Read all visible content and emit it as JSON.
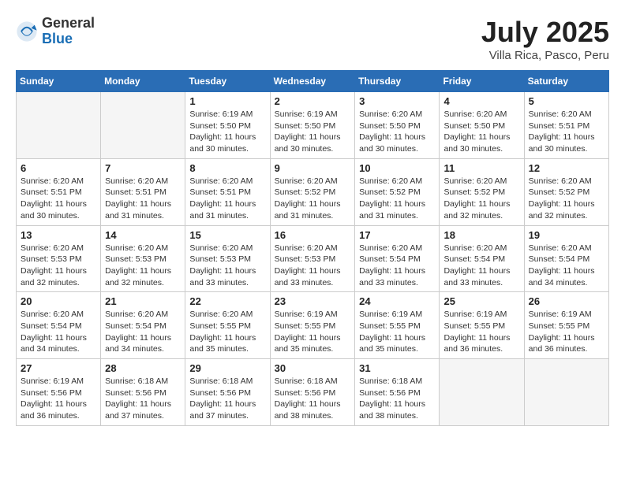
{
  "header": {
    "logo_general": "General",
    "logo_blue": "Blue",
    "month_title": "July 2025",
    "subtitle": "Villa Rica, Pasco, Peru"
  },
  "weekdays": [
    "Sunday",
    "Monday",
    "Tuesday",
    "Wednesday",
    "Thursday",
    "Friday",
    "Saturday"
  ],
  "weeks": [
    [
      {
        "day": "",
        "info": ""
      },
      {
        "day": "",
        "info": ""
      },
      {
        "day": "1",
        "info": "Sunrise: 6:19 AM\nSunset: 5:50 PM\nDaylight: 11 hours and 30 minutes."
      },
      {
        "day": "2",
        "info": "Sunrise: 6:19 AM\nSunset: 5:50 PM\nDaylight: 11 hours and 30 minutes."
      },
      {
        "day": "3",
        "info": "Sunrise: 6:20 AM\nSunset: 5:50 PM\nDaylight: 11 hours and 30 minutes."
      },
      {
        "day": "4",
        "info": "Sunrise: 6:20 AM\nSunset: 5:50 PM\nDaylight: 11 hours and 30 minutes."
      },
      {
        "day": "5",
        "info": "Sunrise: 6:20 AM\nSunset: 5:51 PM\nDaylight: 11 hours and 30 minutes."
      }
    ],
    [
      {
        "day": "6",
        "info": "Sunrise: 6:20 AM\nSunset: 5:51 PM\nDaylight: 11 hours and 30 minutes."
      },
      {
        "day": "7",
        "info": "Sunrise: 6:20 AM\nSunset: 5:51 PM\nDaylight: 11 hours and 31 minutes."
      },
      {
        "day": "8",
        "info": "Sunrise: 6:20 AM\nSunset: 5:51 PM\nDaylight: 11 hours and 31 minutes."
      },
      {
        "day": "9",
        "info": "Sunrise: 6:20 AM\nSunset: 5:52 PM\nDaylight: 11 hours and 31 minutes."
      },
      {
        "day": "10",
        "info": "Sunrise: 6:20 AM\nSunset: 5:52 PM\nDaylight: 11 hours and 31 minutes."
      },
      {
        "day": "11",
        "info": "Sunrise: 6:20 AM\nSunset: 5:52 PM\nDaylight: 11 hours and 32 minutes."
      },
      {
        "day": "12",
        "info": "Sunrise: 6:20 AM\nSunset: 5:52 PM\nDaylight: 11 hours and 32 minutes."
      }
    ],
    [
      {
        "day": "13",
        "info": "Sunrise: 6:20 AM\nSunset: 5:53 PM\nDaylight: 11 hours and 32 minutes."
      },
      {
        "day": "14",
        "info": "Sunrise: 6:20 AM\nSunset: 5:53 PM\nDaylight: 11 hours and 32 minutes."
      },
      {
        "day": "15",
        "info": "Sunrise: 6:20 AM\nSunset: 5:53 PM\nDaylight: 11 hours and 33 minutes."
      },
      {
        "day": "16",
        "info": "Sunrise: 6:20 AM\nSunset: 5:53 PM\nDaylight: 11 hours and 33 minutes."
      },
      {
        "day": "17",
        "info": "Sunrise: 6:20 AM\nSunset: 5:54 PM\nDaylight: 11 hours and 33 minutes."
      },
      {
        "day": "18",
        "info": "Sunrise: 6:20 AM\nSunset: 5:54 PM\nDaylight: 11 hours and 33 minutes."
      },
      {
        "day": "19",
        "info": "Sunrise: 6:20 AM\nSunset: 5:54 PM\nDaylight: 11 hours and 34 minutes."
      }
    ],
    [
      {
        "day": "20",
        "info": "Sunrise: 6:20 AM\nSunset: 5:54 PM\nDaylight: 11 hours and 34 minutes."
      },
      {
        "day": "21",
        "info": "Sunrise: 6:20 AM\nSunset: 5:54 PM\nDaylight: 11 hours and 34 minutes."
      },
      {
        "day": "22",
        "info": "Sunrise: 6:20 AM\nSunset: 5:55 PM\nDaylight: 11 hours and 35 minutes."
      },
      {
        "day": "23",
        "info": "Sunrise: 6:19 AM\nSunset: 5:55 PM\nDaylight: 11 hours and 35 minutes."
      },
      {
        "day": "24",
        "info": "Sunrise: 6:19 AM\nSunset: 5:55 PM\nDaylight: 11 hours and 35 minutes."
      },
      {
        "day": "25",
        "info": "Sunrise: 6:19 AM\nSunset: 5:55 PM\nDaylight: 11 hours and 36 minutes."
      },
      {
        "day": "26",
        "info": "Sunrise: 6:19 AM\nSunset: 5:55 PM\nDaylight: 11 hours and 36 minutes."
      }
    ],
    [
      {
        "day": "27",
        "info": "Sunrise: 6:19 AM\nSunset: 5:56 PM\nDaylight: 11 hours and 36 minutes."
      },
      {
        "day": "28",
        "info": "Sunrise: 6:18 AM\nSunset: 5:56 PM\nDaylight: 11 hours and 37 minutes."
      },
      {
        "day": "29",
        "info": "Sunrise: 6:18 AM\nSunset: 5:56 PM\nDaylight: 11 hours and 37 minutes."
      },
      {
        "day": "30",
        "info": "Sunrise: 6:18 AM\nSunset: 5:56 PM\nDaylight: 11 hours and 38 minutes."
      },
      {
        "day": "31",
        "info": "Sunrise: 6:18 AM\nSunset: 5:56 PM\nDaylight: 11 hours and 38 minutes."
      },
      {
        "day": "",
        "info": ""
      },
      {
        "day": "",
        "info": ""
      }
    ]
  ]
}
